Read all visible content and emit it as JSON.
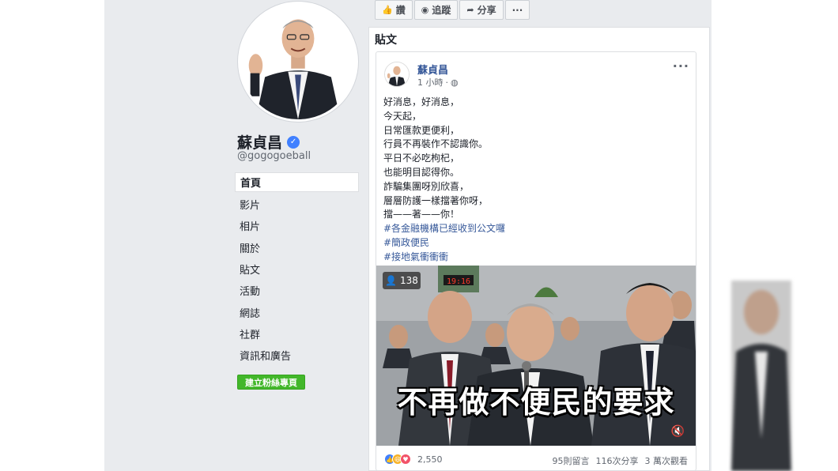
{
  "page": {
    "name": "蘇貞昌",
    "handle": "@gogogoeball",
    "verified_icon": "verified-check-icon"
  },
  "actions": [
    {
      "label": "讚",
      "icon": "thumbs-up-icon"
    },
    {
      "label": "追蹤",
      "icon": "rss-icon"
    },
    {
      "label": "分享",
      "icon": "share-arrow-icon"
    },
    {
      "label": "···",
      "icon": "more-icon"
    }
  ],
  "nav": [
    {
      "label": "首頁",
      "active": true
    },
    {
      "label": "影片"
    },
    {
      "label": "相片"
    },
    {
      "label": "關於"
    },
    {
      "label": "貼文"
    },
    {
      "label": "活動"
    },
    {
      "label": "網誌"
    },
    {
      "label": "社群"
    },
    {
      "label": "資訊和廣告"
    }
  ],
  "create_page_button": "建立粉絲專頁",
  "posts_section_title": "貼文",
  "post": {
    "author": "蘇貞昌",
    "time": "1 小時",
    "privacy_icon": "globe-icon",
    "more": "···",
    "lines": [
      "好消息，好消息，",
      "今天起，",
      "日常匯款更便利，",
      "行員不再裝作不認識你。",
      "平日不必吃枸杞，",
      "也能明目認得你。",
      "詐騙集團呀別欣喜，",
      "層層防護一樣擋著你呀，",
      "擋——著——你！"
    ],
    "hashtags": [
      "#各金融機構已經收到公文囉",
      "#簡政便民",
      "#接地氣衝衝衝"
    ],
    "video": {
      "view_count": "138",
      "caption": "不再做不便民的要求",
      "board_text": "19:16",
      "mute_icon": "speaker-mute-icon"
    },
    "reaction_count": "2,550",
    "comments": "95則留言",
    "shares": "116次分享",
    "views": "3 萬次觀看"
  },
  "colors": {
    "page_bg": "#e9ebee",
    "link_blue": "#365899",
    "green_button": "#42b72a",
    "like_blue": "#4080ff",
    "haha_yellow": "#f7b125",
    "love_red": "#f25268"
  }
}
